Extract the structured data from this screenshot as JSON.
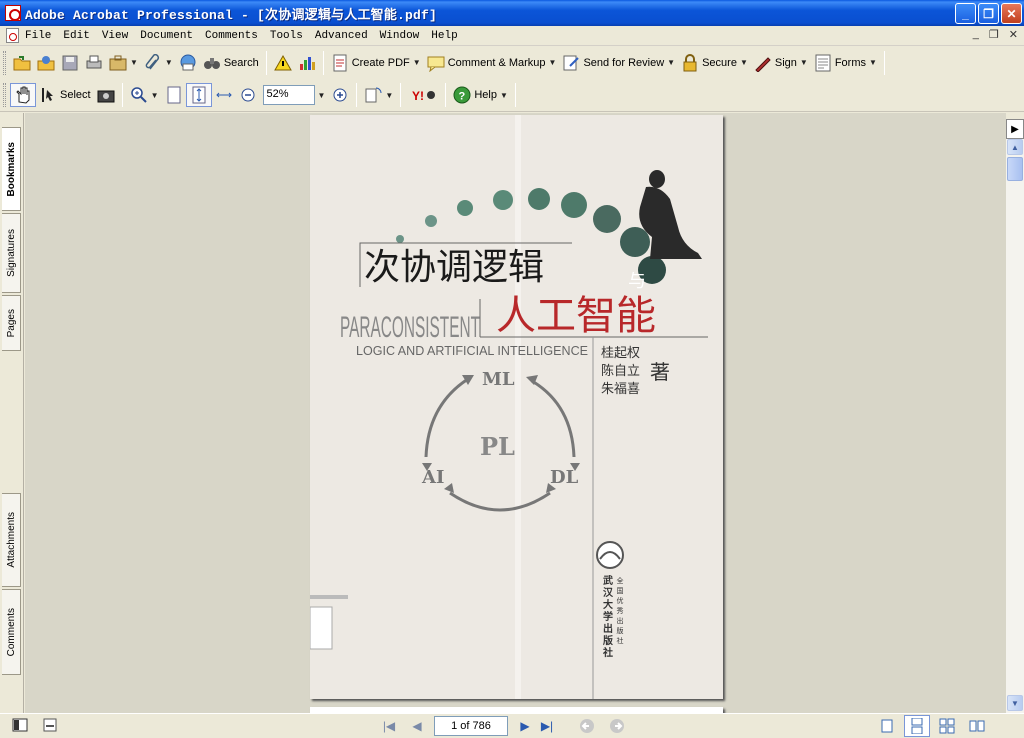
{
  "window": {
    "title": "Adobe Acrobat Professional - [次协调逻辑与人工智能.pdf]"
  },
  "menu": {
    "items": [
      "File",
      "Edit",
      "View",
      "Document",
      "Comments",
      "Tools",
      "Advanced",
      "Window",
      "Help"
    ]
  },
  "toolbar1": {
    "search_label": "Search",
    "create_pdf_label": "Create PDF",
    "comment_label": "Comment & Markup",
    "review_label": "Send for Review",
    "secure_label": "Secure",
    "sign_label": "Sign",
    "forms_label": "Forms"
  },
  "toolbar2": {
    "select_label": "Select",
    "zoom_value": "52%",
    "help_label": "Help"
  },
  "leftnav": {
    "tabs": [
      "Bookmarks",
      "Signatures",
      "Pages",
      "Attachments",
      "Comments"
    ]
  },
  "cover": {
    "title_cn_1": "次协调逻辑",
    "title_cn_yu": "与",
    "title_cn_2": "人工智能",
    "title_en_1": "PARACONSISTENT",
    "title_en_2": "LOGIC AND ARTIFICIAL INTELLIGENCE",
    "authors": [
      "桂起权",
      "陈自立",
      "朱福喜"
    ],
    "zhu": "著",
    "diagram": {
      "top": "ML",
      "center": "PL",
      "left": "AI",
      "right": "DL"
    },
    "publisher_line1": "武汉大学出版社",
    "publisher_line2": "全国优秀出版社"
  },
  "statusbar": {
    "page_indicator": "1 of 786"
  },
  "colors": {
    "title_blue": "#0a4fd0",
    "cover_red": "#b8282a",
    "dot_green": "#5a8a78"
  }
}
